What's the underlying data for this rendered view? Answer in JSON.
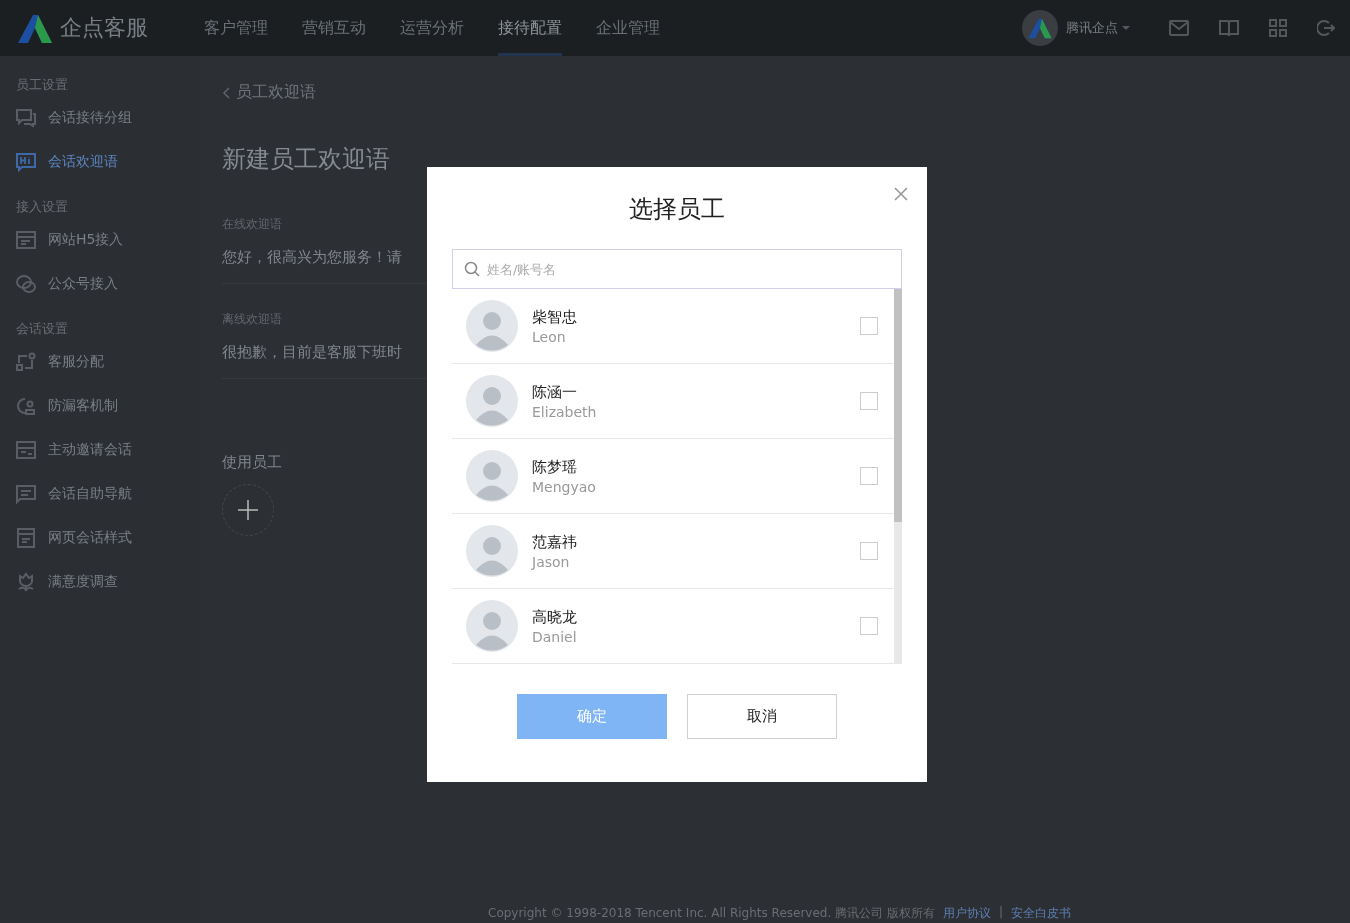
{
  "header": {
    "logo": "企点客服",
    "nav": [
      {
        "label": "客户管理",
        "selected": false
      },
      {
        "label": "营销互动",
        "selected": false
      },
      {
        "label": "运营分析",
        "selected": false
      },
      {
        "label": "接待配置",
        "selected": true
      },
      {
        "label": "企业管理",
        "selected": false
      }
    ],
    "account": "腾讯企点"
  },
  "sidebar": [
    {
      "title": "员工设置",
      "items": [
        {
          "label": "会话接待分组",
          "kind": "chat",
          "selected": false
        },
        {
          "label": "会话欢迎语",
          "kind": "hi",
          "selected": true
        }
      ]
    },
    {
      "title": "接入设置",
      "items": [
        {
          "label": "网站H5接入",
          "kind": "web",
          "selected": false
        },
        {
          "label": "公众号接入",
          "kind": "wechat",
          "selected": false
        }
      ]
    },
    {
      "title": "会话设置",
      "items": [
        {
          "label": "客服分配",
          "kind": "route",
          "selected": false
        },
        {
          "label": "防漏客机制",
          "kind": "guard",
          "selected": false
        },
        {
          "label": "主动邀请会话",
          "kind": "form",
          "selected": false
        },
        {
          "label": "会话自助导航",
          "kind": "note",
          "selected": false
        },
        {
          "label": "网页会话样式",
          "kind": "page",
          "selected": false
        },
        {
          "label": "满意度调查",
          "kind": "flower",
          "selected": false
        }
      ]
    }
  ],
  "page": {
    "back": "员工欢迎语",
    "title": "新建员工欢迎语",
    "fields": [
      {
        "label": "在线欢迎语",
        "value": "您好，很高兴为您服务！请"
      },
      {
        "label": "离线欢迎语",
        "value": "很抱歉，目前是客服下班时"
      }
    ],
    "staff_label": "使用员工"
  },
  "dialog": {
    "title": "选择员工",
    "search": {
      "placeholder": "姓名/账号名"
    },
    "staff": [
      {
        "name": "柴智忠",
        "account": "Leon",
        "checked": false
      },
      {
        "name": "陈涵一",
        "account": "Elizabeth",
        "checked": false
      },
      {
        "name": "陈梦瑶",
        "account": "Mengyao",
        "checked": false
      },
      {
        "name": "范嘉祎",
        "account": "Jason",
        "checked": false
      },
      {
        "name": "高晓龙",
        "account": "Daniel",
        "checked": false
      }
    ],
    "buttons": [
      {
        "label": "确定",
        "kind": "primary"
      },
      {
        "label": "取消",
        "kind": "secondary"
      }
    ]
  },
  "footer": {
    "copyright": "Copyright © 1998-2018 Tencent Inc. All Rights Reserved. 腾讯公司 版权所有",
    "links": [
      "用户协议",
      "安全白皮书"
    ],
    "separator": "|"
  }
}
